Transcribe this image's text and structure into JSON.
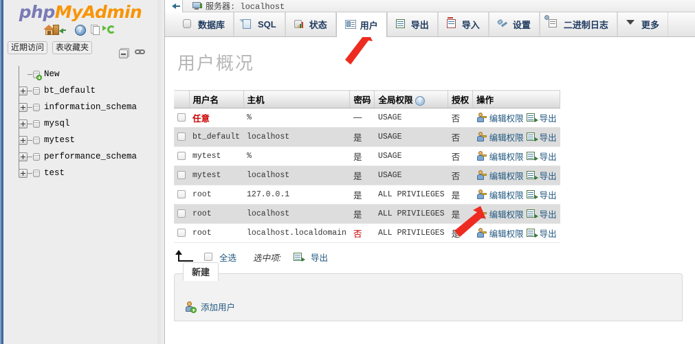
{
  "sidebar": {
    "logo": {
      "php": "php",
      "my": "MyAdmin"
    },
    "top_icons": [
      {
        "name": "home-icon",
        "label": "主页"
      },
      {
        "name": "logout-icon",
        "label": "退出"
      },
      {
        "name": "help-icon",
        "label": "帮助",
        "glyph": "?"
      },
      {
        "name": "docs-icon",
        "label": "文档"
      },
      {
        "name": "reload-icon",
        "label": "重新加载"
      }
    ],
    "quicklinks": [
      {
        "label": "近期访问"
      },
      {
        "label": "表收藏夹"
      }
    ],
    "tree_controls": [
      {
        "name": "collapse-all-icon"
      },
      {
        "name": "link-with-main-panel-icon"
      }
    ],
    "tree": [
      {
        "label": "New",
        "expandable": false,
        "new": true
      },
      {
        "label": "bt_default",
        "expandable": true,
        "new": false
      },
      {
        "label": "information_schema",
        "expandable": true,
        "new": false
      },
      {
        "label": "mysql",
        "expandable": true,
        "new": false
      },
      {
        "label": "mytest",
        "expandable": true,
        "new": false
      },
      {
        "label": "performance_schema",
        "expandable": true,
        "new": false
      },
      {
        "label": "test",
        "expandable": true,
        "new": false
      }
    ]
  },
  "serverbar": {
    "back_label": "",
    "title": "服务器: localhost"
  },
  "tabs": [
    {
      "label": "数据库",
      "icon": "database-icon",
      "active": false
    },
    {
      "label": "SQL",
      "icon": "sql-icon",
      "active": false
    },
    {
      "label": "状态",
      "icon": "status-icon",
      "active": false
    },
    {
      "label": "用户",
      "icon": "users-icon",
      "active": true
    },
    {
      "label": "导出",
      "icon": "export-icon",
      "active": false
    },
    {
      "label": "导入",
      "icon": "import-icon",
      "active": false
    },
    {
      "label": "设置",
      "icon": "settings-icon",
      "active": false
    },
    {
      "label": "二进制日志",
      "icon": "binlog-icon",
      "active": false
    },
    {
      "label": "更多",
      "icon": "chevron-down-icon",
      "active": false
    }
  ],
  "page": {
    "title": "用户概况"
  },
  "table": {
    "headers": {
      "checkbox": "",
      "user": "用户名",
      "host": "主机",
      "password": "密码",
      "global_privs": "全局权限",
      "help_glyph": "?",
      "grant": "授权",
      "action": "操作"
    },
    "rows": [
      {
        "user": "任意",
        "user_any": true,
        "host": "%",
        "password": "—",
        "privileges": "USAGE",
        "grant": "否",
        "edit": "编辑权限",
        "export": "导出",
        "password_red": false
      },
      {
        "user": "bt_default",
        "user_any": false,
        "host": "localhost",
        "password": "是",
        "privileges": "USAGE",
        "grant": "否",
        "edit": "编辑权限",
        "export": "导出",
        "password_red": false
      },
      {
        "user": "mytest",
        "user_any": false,
        "host": "%",
        "password": "是",
        "privileges": "USAGE",
        "grant": "否",
        "edit": "编辑权限",
        "export": "导出",
        "password_red": false
      },
      {
        "user": "mytest",
        "user_any": false,
        "host": "localhost",
        "password": "是",
        "privileges": "USAGE",
        "grant": "否",
        "edit": "编辑权限",
        "export": "导出",
        "password_red": false
      },
      {
        "user": "root",
        "user_any": false,
        "host": "127.0.0.1",
        "password": "是",
        "privileges": "ALL PRIVILEGES",
        "grant": "是",
        "edit": "编辑权限",
        "export": "导出",
        "password_red": false
      },
      {
        "user": "root",
        "user_any": false,
        "host": "localhost",
        "password": "是",
        "privileges": "ALL PRIVILEGES",
        "grant": "是",
        "edit": "编辑权限",
        "export": "导出",
        "password_red": false
      },
      {
        "user": "root",
        "user_any": false,
        "host": "localhost.localdomain",
        "password": "否",
        "privileges": "ALL PRIVILEGES",
        "grant": "是",
        "edit": "编辑权限",
        "export": "导出",
        "password_red": true
      }
    ]
  },
  "footer": {
    "check_all": "全选",
    "with_selected": "选中项:",
    "export": "导出"
  },
  "new_panel": {
    "tab_label": "新建",
    "add_user": "添加用户"
  },
  "annotations": {
    "arrow_color": "#ee2b20"
  }
}
